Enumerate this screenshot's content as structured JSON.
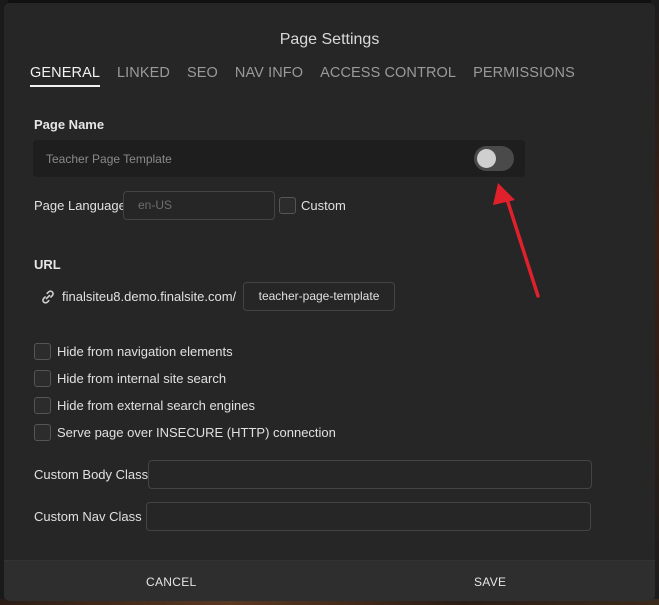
{
  "modal": {
    "title": "Page Settings"
  },
  "tabs": [
    {
      "label": "GENERAL",
      "active": true
    },
    {
      "label": "LINKED"
    },
    {
      "label": "SEO"
    },
    {
      "label": "NAV INFO"
    },
    {
      "label": "ACCESS CONTROL"
    },
    {
      "label": "PERMISSIONS"
    }
  ],
  "page_name": {
    "label": "Page Name",
    "value": "Teacher Page Template",
    "toggle_on": false
  },
  "page_language": {
    "label": "Page Language",
    "placeholder": "en-US",
    "custom_label": "Custom"
  },
  "url": {
    "label": "URL",
    "base": "finalsiteu8.demo.finalsite.com/",
    "slug": "teacher-page-template"
  },
  "options": [
    {
      "label": "Hide from navigation elements",
      "checked": false
    },
    {
      "label": "Hide from internal site search",
      "checked": false
    },
    {
      "label": "Hide from external search engines",
      "checked": false
    },
    {
      "label": "Serve page over INSECURE (HTTP) connection",
      "checked": false
    }
  ],
  "custom_body_class": {
    "label": "Custom Body Class",
    "value": ""
  },
  "custom_nav_class": {
    "label": "Custom Nav Class",
    "value": ""
  },
  "footer": {
    "cancel_label": "CANCEL",
    "save_label": "SAVE"
  },
  "colors": {
    "annotation_arrow": "#e0202a",
    "modal_bg": "#262626"
  }
}
